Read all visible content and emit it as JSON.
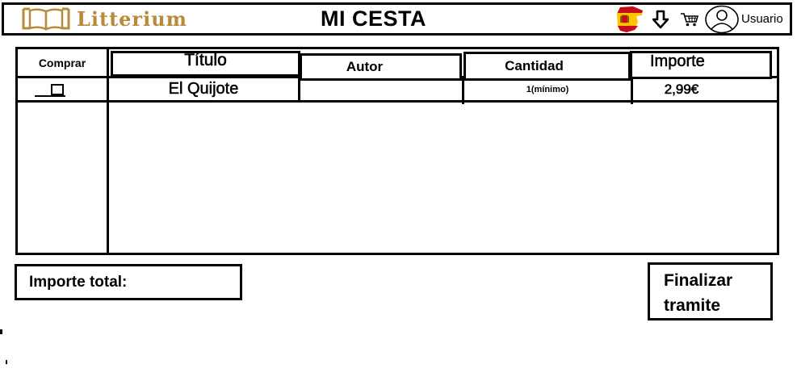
{
  "header": {
    "logo_text": "Litterium",
    "title": "MI CESTA",
    "user_label": "Usuario",
    "icons": [
      "book-logo-icon",
      "spain-flag-icon",
      "download-arrow-icon",
      "cart-icon",
      "user-avatar-icon"
    ]
  },
  "table": {
    "headers": {
      "comprar": "Comprar",
      "titulo": "Título",
      "autor": "Autor",
      "cantidad": "Cantidad",
      "importe": "Importe"
    },
    "rows": [
      {
        "checked": false,
        "titulo": "El Quijote",
        "autor": "",
        "cantidad": "1(mínimo)",
        "importe": "2,99€"
      }
    ]
  },
  "footer": {
    "total_label": "Importe total:",
    "finish_line1": "Finalizar",
    "finish_line2": "tramite"
  },
  "colors": {
    "logo_gold": "#b88a3c",
    "border": "#000000",
    "flag_red": "#c60b1e",
    "flag_yellow": "#ffc400"
  }
}
